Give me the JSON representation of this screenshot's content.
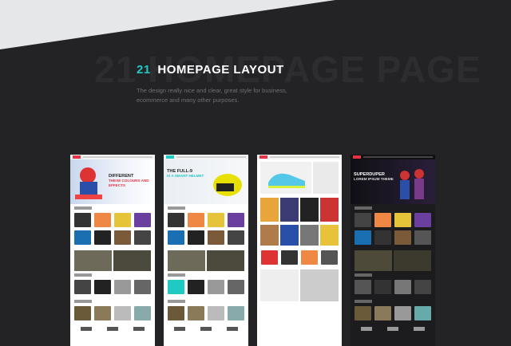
{
  "section": {
    "ghost_text": "21 HOMEPAGE",
    "number": "21",
    "title": "HOMEPAGE LAYOUT",
    "description": "The design really nice and clear, great style for business, ecommerce and many other purposes."
  },
  "previews": [
    {
      "hero_title": "DIFFERENT",
      "hero_sub": "THESE COLOURS AND EFFECTS",
      "theme": "light",
      "accent": "#e63245"
    },
    {
      "hero_title": "THE FULL-9",
      "hero_sub": "IS A SMART HELMET",
      "theme": "light",
      "accent": "#1fc9c4"
    },
    {
      "hero_title": "",
      "hero_sub": "",
      "theme": "light",
      "accent": "#e63245"
    },
    {
      "hero_title": "SUPERDUPER",
      "hero_sub": "LOREM IPSUM THEME",
      "theme": "dark",
      "accent": "#e63245"
    }
  ],
  "colors": {
    "background": "#232325",
    "accent": "#1fc9c4",
    "band": "#e6e7e9"
  }
}
